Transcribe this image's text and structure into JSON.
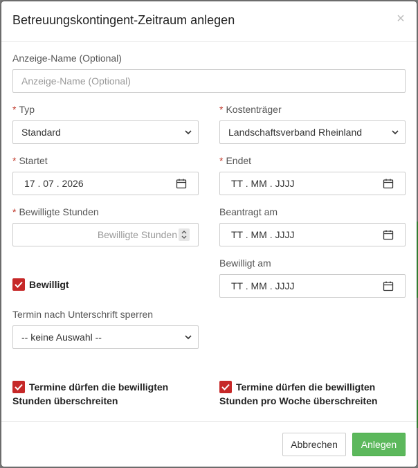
{
  "modal": {
    "title": "Betreuungskontingent-Zeitraum anlegen",
    "close_label": "×"
  },
  "form": {
    "display_name": {
      "label": "Anzeige-Name (Optional)",
      "placeholder": "Anzeige-Name (Optional)"
    },
    "typ": {
      "label": "Typ",
      "value": "Standard"
    },
    "kostentraeger": {
      "label": "Kostenträger",
      "value": "Landschaftsverband Rheinland"
    },
    "startet": {
      "label": "Startet",
      "value": "17 . 07 . 2026"
    },
    "endet": {
      "label": "Endet",
      "value": "TT . MM . JJJJ"
    },
    "bewilligte_stunden": {
      "label": "Bewilligte Stunden",
      "placeholder": "Bewilligte Stunden"
    },
    "beantragt_am": {
      "label": "Beantragt am",
      "value": "TT . MM . JJJJ"
    },
    "bewilligt_am": {
      "label": "Bewilligt am",
      "value": "TT . MM . JJJJ"
    },
    "bewilligt": {
      "label": "Bewilligt",
      "checked": true
    },
    "termin_sperren": {
      "label": "Termin nach Unterschrift sperren",
      "value": "-- keine Auswahl --"
    },
    "ueberschreiten": {
      "line1": "Termine dürfen die bewilligten",
      "line2": "Stunden überschreiten",
      "checked": true
    },
    "ueberschreiten_woche": {
      "line1": "Termine dürfen die bewilligten",
      "line2": "Stunden pro Woche überschreiten",
      "checked": true
    },
    "required_marker": "*"
  },
  "footer": {
    "cancel_label": "Abbrechen",
    "submit_label": "Anlegen"
  },
  "colors": {
    "accent_red": "#c62828",
    "primary_green": "#5cb85c"
  }
}
